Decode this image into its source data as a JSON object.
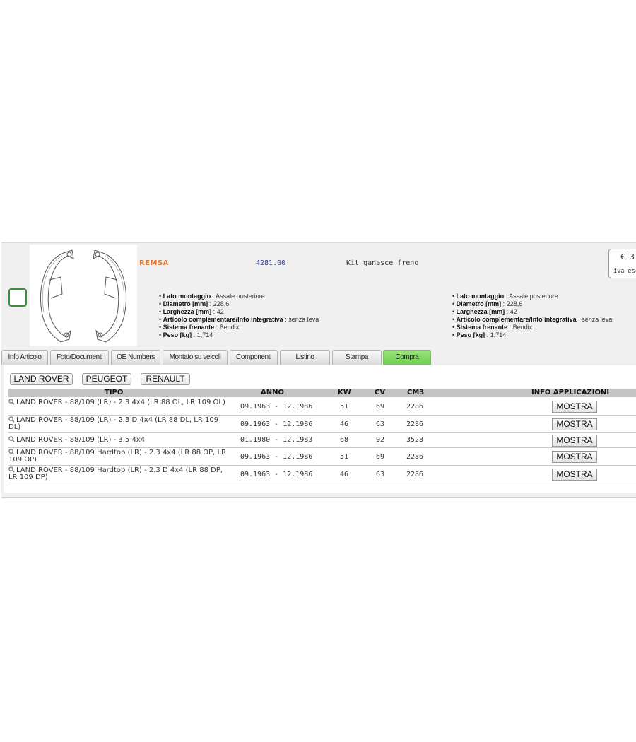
{
  "product": {
    "brand": "REMSA",
    "code": "4281.00",
    "description": "Kit ganasce freno",
    "price_prefix": "€ 3",
    "price_note": "iva esc",
    "image_icon": "brake-shoe-drawing"
  },
  "specs": [
    {
      "label": "Lato montaggio",
      "value": "Assale posteriore"
    },
    {
      "label": "Diametro [mm]",
      "value": "228,6"
    },
    {
      "label": "Larghezza [mm]",
      "value": "42"
    },
    {
      "label": "Articolo complementare/Info integrativa",
      "value": "senza leva"
    },
    {
      "label": "Sistema frenante",
      "value": "Bendix"
    },
    {
      "label": "Peso [kg]",
      "value": "1,714"
    }
  ],
  "tabs": [
    {
      "label": "Info Articolo"
    },
    {
      "label": "Foto/Documenti"
    },
    {
      "label": "OE Numbers"
    },
    {
      "label": "Montato su veicoli"
    },
    {
      "label": "Componenti"
    },
    {
      "label": "Listino"
    },
    {
      "label": "Stampa"
    },
    {
      "label": "Compra",
      "active": true
    }
  ],
  "brand_filters": [
    "LAND ROVER",
    "PEUGEOT",
    "RENAULT"
  ],
  "table": {
    "headers": {
      "tipo": "TIPO",
      "anno": "ANNO",
      "kw": "KW",
      "cv": "CV",
      "cm3": "CM3",
      "info": "INFO APPLICAZIONI"
    },
    "rows": [
      {
        "tipo": "LAND ROVER - 88/109 (LR) - 2.3 4x4 (LR 88 OL, LR 109 OL)",
        "anno": "09.1963 - 12.1986",
        "kw": "51",
        "cv": "69",
        "cm3": "2286",
        "action": "MOSTRA"
      },
      {
        "tipo": "LAND ROVER - 88/109 (LR) - 2.3 D 4x4 (LR 88 DL, LR 109 DL)",
        "anno": "09.1963 - 12.1986",
        "kw": "46",
        "cv": "63",
        "cm3": "2286",
        "action": "MOSTRA"
      },
      {
        "tipo": "LAND ROVER - 88/109 (LR) - 3.5 4x4",
        "anno": "01.1980 - 12.1983",
        "kw": "68",
        "cv": "92",
        "cm3": "3528",
        "action": "MOSTRA"
      },
      {
        "tipo": "LAND ROVER - 88/109 Hardtop (LR) - 2.3 4x4 (LR 88 OP, LR 109 OP)",
        "anno": "09.1963 - 12.1986",
        "kw": "51",
        "cv": "69",
        "cm3": "2286",
        "action": "MOSTRA"
      },
      {
        "tipo": "LAND ROVER - 88/109 Hardtop (LR) - 2.3 D 4x4 (LR 88 DP, LR 109 DP)",
        "anno": "09.1963 - 12.1986",
        "kw": "46",
        "cv": "63",
        "cm3": "2286",
        "action": "MOSTRA"
      }
    ]
  },
  "colors": {
    "brand": "#e0752f",
    "code": "#2d3b8f",
    "active_tab": "#6fcf4f",
    "checkbox": "#3a8f3a"
  }
}
